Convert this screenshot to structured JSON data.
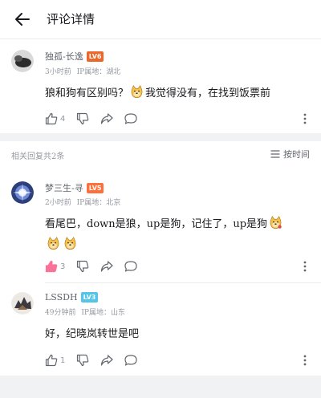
{
  "header": {
    "title": "评论详情"
  },
  "main_comment": {
    "username": "独孤-长逸",
    "level": "LV6",
    "time": "3小时前",
    "ip": "IP属地：湖北",
    "text_before": "狼和狗有区别吗？",
    "text_after": "我觉得没有，在找到饭票前",
    "like_count": "4"
  },
  "related": {
    "title": "相关回复共2条",
    "sort_label": "按时间"
  },
  "replies": [
    {
      "username": "梦三生-寻",
      "level": "LV5",
      "time": "2小时前",
      "ip": "IP属地：北京",
      "text": "看尾巴，down是狼，up是狗，记住了，up是狗",
      "like_count": "3",
      "liked": true
    },
    {
      "username": "LSSDH",
      "level": "LV3",
      "time": "49分钟前",
      "ip": "IP属地：山东",
      "text": "好，纪晓岚转世是吧",
      "like_count": "1",
      "liked": false
    }
  ],
  "colors": {
    "accent_pink": "#fb7299",
    "muted": "#9499a0",
    "band": "#f1f2f3"
  },
  "icons": [
    "back-arrow-icon",
    "thumb-up-icon",
    "thumb-down-icon",
    "share-icon",
    "comment-icon",
    "more-icon",
    "sort-icon",
    "doge-emoji-icon"
  ]
}
